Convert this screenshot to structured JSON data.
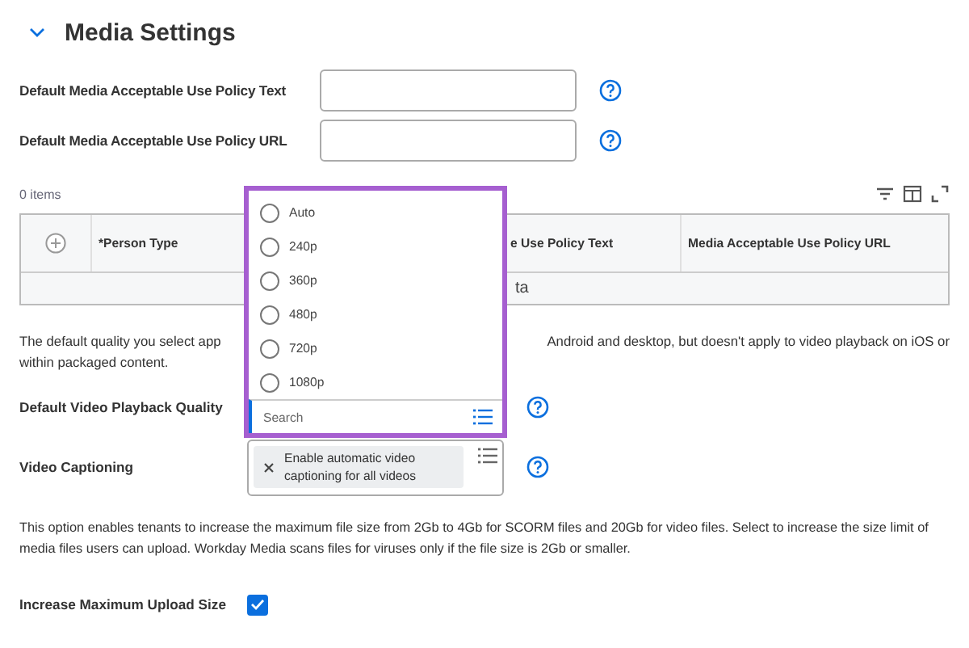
{
  "section": {
    "title": "Media Settings",
    "expanded": true
  },
  "fields": [
    {
      "label": "Default Media Acceptable Use Policy Text"
    },
    {
      "label": "Default Media Acceptable Use Policy URL"
    }
  ],
  "table": {
    "count": "0 items",
    "columns": [
      "*Person Type",
      "e Use Policy Text",
      "Media Acceptable Use Policy URL"
    ],
    "empty_message": "ta"
  },
  "quality_note": {
    "line_start": "The default quality you select app",
    "line_end": "Android and desktop, but doesn't apply to video playback on iOS or",
    "line_2": "within packaged content."
  },
  "playback_quality": {
    "label": "Default Video Playback Quality",
    "search_placeholder": "Search",
    "options": [
      {
        "label": "Auto",
        "selected": false
      },
      {
        "label": "240p",
        "selected": false
      },
      {
        "label": "360p",
        "selected": false
      },
      {
        "label": "480p",
        "selected": false
      },
      {
        "label": "720p",
        "selected": false
      },
      {
        "label": "1080p",
        "selected": false
      }
    ]
  },
  "captioning": {
    "label": "Video Captioning",
    "chips": [
      "Enable automatic video captioning for all videos"
    ]
  },
  "upload_note": "This option enables tenants to increase the maximum file size from 2Gb to 4Gb for SCORM files and 20Gb for video files. Select to increase the size limit of media files users can upload. Workday Media scans files for viruses only if the file size is 2Gb or smaller.",
  "upload": {
    "label": "Increase Maximum Upload Size",
    "checked": true
  }
}
